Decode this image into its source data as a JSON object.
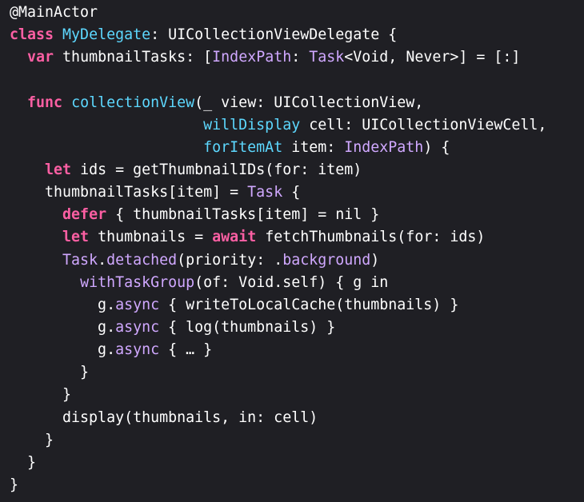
{
  "colors": {
    "background": "#1f1f24",
    "keyword": "#fc5fa3",
    "type": "#d0a8ff",
    "declaration": "#5dd8ff",
    "plain": "#ffffff"
  },
  "code_lines": [
    [
      {
        "t": "@MainActor",
        "c": "plain"
      }
    ],
    [
      {
        "t": "class",
        "c": "kw"
      },
      {
        "t": " ",
        "c": "plain"
      },
      {
        "t": "MyDelegate",
        "c": "decl"
      },
      {
        "t": ": UICollectionViewDelegate {",
        "c": "plain"
      }
    ],
    [
      {
        "t": "  ",
        "c": "plain"
      },
      {
        "t": "var",
        "c": "kw"
      },
      {
        "t": " thumbnailTasks: [",
        "c": "plain"
      },
      {
        "t": "IndexPath",
        "c": "type"
      },
      {
        "t": ": ",
        "c": "plain"
      },
      {
        "t": "Task",
        "c": "type"
      },
      {
        "t": "<Void, Never>] = [:]",
        "c": "plain"
      }
    ],
    [],
    [
      {
        "t": "  ",
        "c": "plain"
      },
      {
        "t": "func",
        "c": "kw"
      },
      {
        "t": " ",
        "c": "plain"
      },
      {
        "t": "collectionView",
        "c": "decl"
      },
      {
        "t": "(_ view: UICollectionView,",
        "c": "plain"
      }
    ],
    [
      {
        "t": "                      ",
        "c": "plain"
      },
      {
        "t": "willDisplay",
        "c": "decl"
      },
      {
        "t": " cell: UICollectionViewCell,",
        "c": "plain"
      }
    ],
    [
      {
        "t": "                      ",
        "c": "plain"
      },
      {
        "t": "forItemAt",
        "c": "decl"
      },
      {
        "t": " item: ",
        "c": "plain"
      },
      {
        "t": "IndexPath",
        "c": "type"
      },
      {
        "t": ") {",
        "c": "plain"
      }
    ],
    [
      {
        "t": "    ",
        "c": "plain"
      },
      {
        "t": "let",
        "c": "kw"
      },
      {
        "t": " ids = getThumbnailIDs(for: item)",
        "c": "plain"
      }
    ],
    [
      {
        "t": "    thumbnailTasks[item] = ",
        "c": "plain"
      },
      {
        "t": "Task",
        "c": "type"
      },
      {
        "t": " {",
        "c": "plain"
      }
    ],
    [
      {
        "t": "      ",
        "c": "plain"
      },
      {
        "t": "defer",
        "c": "kw"
      },
      {
        "t": " { thumbnailTasks[item] = nil }",
        "c": "plain"
      }
    ],
    [
      {
        "t": "      ",
        "c": "plain"
      },
      {
        "t": "let",
        "c": "kw"
      },
      {
        "t": " thumbnails = ",
        "c": "plain"
      },
      {
        "t": "await",
        "c": "kw"
      },
      {
        "t": " fetchThumbnails(for: ids)",
        "c": "plain"
      }
    ],
    [
      {
        "t": "      ",
        "c": "plain"
      },
      {
        "t": "Task",
        "c": "type"
      },
      {
        "t": ".",
        "c": "plain"
      },
      {
        "t": "detached",
        "c": "type"
      },
      {
        "t": "(priority: .",
        "c": "plain"
      },
      {
        "t": "background",
        "c": "type"
      },
      {
        "t": ")",
        "c": "plain"
      }
    ],
    [
      {
        "t": "        ",
        "c": "plain"
      },
      {
        "t": "withTaskGroup",
        "c": "type"
      },
      {
        "t": "(of: Void.self) { g in",
        "c": "plain"
      }
    ],
    [
      {
        "t": "          g.",
        "c": "plain"
      },
      {
        "t": "async",
        "c": "type"
      },
      {
        "t": " { writeToLocalCache(thumbnails) }",
        "c": "plain"
      }
    ],
    [
      {
        "t": "          g.",
        "c": "plain"
      },
      {
        "t": "async",
        "c": "type"
      },
      {
        "t": " { log(thumbnails) }",
        "c": "plain"
      }
    ],
    [
      {
        "t": "          g.",
        "c": "plain"
      },
      {
        "t": "async",
        "c": "type"
      },
      {
        "t": " { … }",
        "c": "plain"
      }
    ],
    [
      {
        "t": "        }",
        "c": "plain"
      }
    ],
    [
      {
        "t": "      }",
        "c": "plain"
      }
    ],
    [
      {
        "t": "      display(thumbnails, in: cell)",
        "c": "plain"
      }
    ],
    [
      {
        "t": "    }",
        "c": "plain"
      }
    ],
    [
      {
        "t": "  }",
        "c": "plain"
      }
    ],
    [
      {
        "t": "}",
        "c": "plain"
      }
    ]
  ]
}
